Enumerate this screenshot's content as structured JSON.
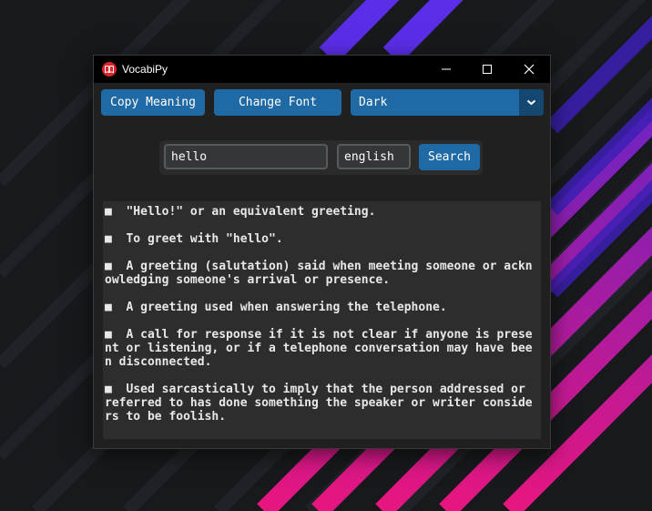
{
  "window": {
    "title": "VocabiPy"
  },
  "toolbar": {
    "copy_label": "Copy Meaning",
    "font_label": "Change Font",
    "theme_value": "Dark"
  },
  "search": {
    "query": "hello",
    "language": "english",
    "button_label": "Search"
  },
  "meanings": [
    "\"Hello!\" or an equivalent greeting.",
    "To greet with \"hello\".",
    "A greeting (salutation) said when meeting someone or acknowledging someone's arrival or presence.",
    "A greeting used when answering the telephone.",
    "A call for response if it is not clear if anyone is present or listening, or if a telephone conversation may have been disconnected.",
    "Used sarcastically to imply that the person addressed or referred to has done something the speaker or writer considers to be foolish."
  ],
  "bullet": "■",
  "colors": {
    "accent": "#1f6aa5",
    "accent_dark": "#144870",
    "window_bg": "#202020",
    "textbox_bg": "#2d2d2d",
    "titlebar_bg": "#000000",
    "app_icon": "#d9232e"
  },
  "icons": {
    "app": "open-book-icon",
    "minimize": "minimize-icon",
    "maximize": "maximize-icon",
    "close": "close-icon",
    "dropdown": "chevron-down-icon"
  }
}
